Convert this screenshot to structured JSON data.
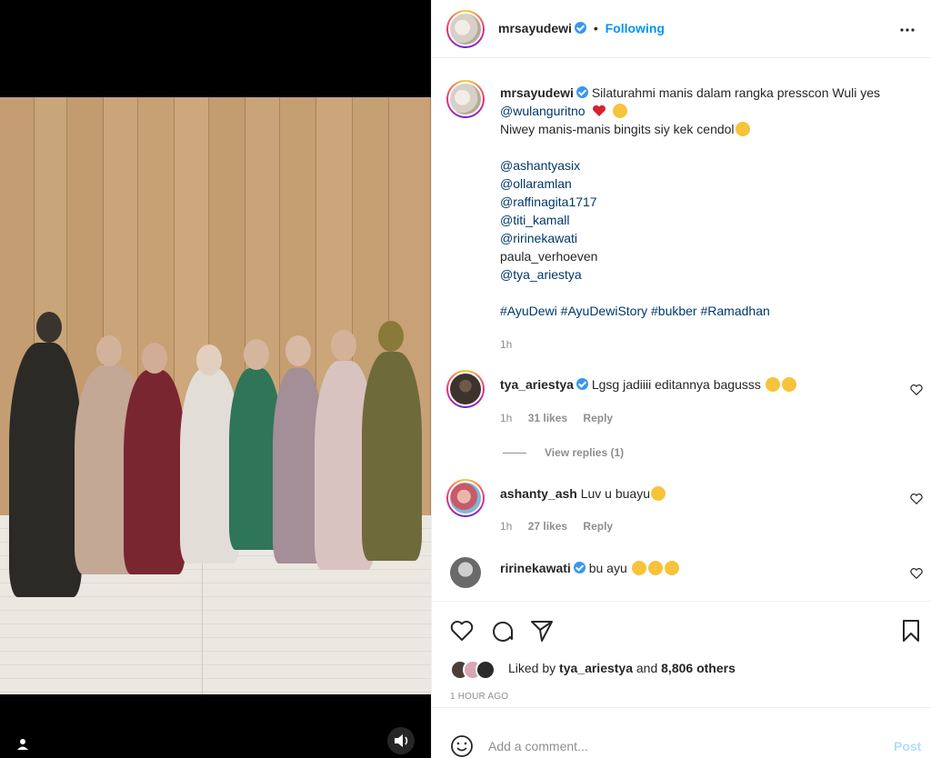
{
  "post": {
    "author": "mrsayudewi",
    "following_label": "Following",
    "separator": "•",
    "more_icon": "more-horizontal-icon",
    "time_ago": "1h",
    "posted_label": "1 HOUR AGO"
  },
  "caption": {
    "line1_text": "Silaturahmi manis dalam rangka presscon Wuli yes",
    "line2_mention": "@wulanguritno",
    "line3_text": "Niwey manis-manis bingits siy kek cendol",
    "tags": [
      "@ashantyasix",
      "@ollaramlan",
      "@raffinagita1717",
      "@titi_kamall",
      "@ririnekawati",
      "paula_verhoeven",
      "@tya_ariestya"
    ],
    "hashtags": "#AyuDewi #AyuDewiStory #bukber #Ramadhan"
  },
  "comments": [
    {
      "user": "tya_ariestya",
      "text": "Lgsg jadiiii editannya bagusss",
      "time": "1h",
      "likes": "31 likes",
      "reply": "Reply",
      "view_replies": "View replies (1)"
    },
    {
      "user": "ashanty_ash",
      "text": "Luv u buayu",
      "time": "1h",
      "likes": "27 likes",
      "reply": "Reply"
    },
    {
      "user": "ririnekawati",
      "text": "bu ayu"
    }
  ],
  "likes": {
    "prefix": "Liked by",
    "user": "tya_ariestya",
    "and": "and",
    "others": "8,806 others"
  },
  "add_comment": {
    "placeholder": "Add a comment...",
    "post_label": "Post"
  },
  "colors": {
    "accent_blue": "#0095f6",
    "verified": "#3897f0",
    "heart_red": "#ed4956",
    "muted": "#8e8e8e"
  }
}
